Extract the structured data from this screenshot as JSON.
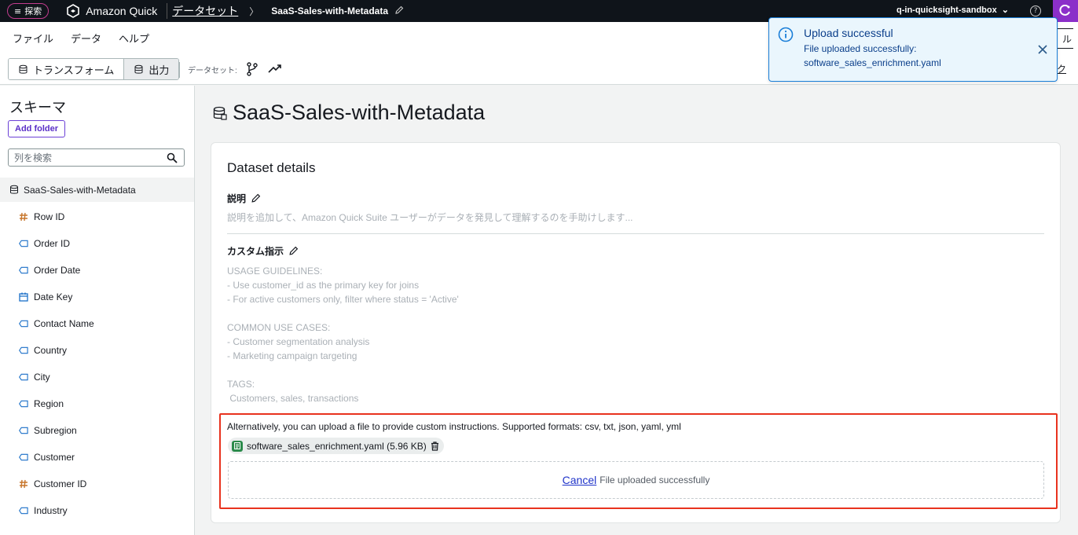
{
  "topbar": {
    "explore_label": "探索",
    "brand": "Amazon Quick",
    "breadcrumb_parent": "データセット",
    "breadcrumb_current": "SaaS-Sales-with-Metadata",
    "account": "q-in-quicksight-sandbox",
    "help": "?"
  },
  "menu": {
    "items": [
      "ファイル",
      "データ",
      "ヘルプ"
    ]
  },
  "toolbar": {
    "transform_label": "トランスフォーム",
    "output_label": "出力",
    "dataset_label": "データセット:",
    "right_button_fragment": "ル",
    "right_link_fragment": "ク"
  },
  "sidebar": {
    "title": "スキーマ",
    "add_folder": "Add folder",
    "search_placeholder": "列を検索",
    "dataset_name": "SaaS-Sales-with-Metadata",
    "fields": [
      {
        "name": "Row ID",
        "type": "number"
      },
      {
        "name": "Order ID",
        "type": "string"
      },
      {
        "name": "Order Date",
        "type": "string"
      },
      {
        "name": "Date Key",
        "type": "date"
      },
      {
        "name": "Contact Name",
        "type": "string"
      },
      {
        "name": "Country",
        "type": "string"
      },
      {
        "name": "City",
        "type": "string"
      },
      {
        "name": "Region",
        "type": "string"
      },
      {
        "name": "Subregion",
        "type": "string"
      },
      {
        "name": "Customer",
        "type": "string"
      },
      {
        "name": "Customer ID",
        "type": "number"
      },
      {
        "name": "Industry",
        "type": "string"
      }
    ]
  },
  "main": {
    "title": "SaaS-Sales-with-Metadata",
    "card_title": "Dataset details",
    "description_label": "説明",
    "description_placeholder": "説明を追加して、Amazon Quick Suite ユーザーがデータを発見して理解するのを手助けします...",
    "custom_label": "カスタム指示",
    "custom_instructions": "USAGE GUIDELINES:\n- Use customer_id as the primary key for joins\n- For active customers only, filter where status = 'Active'\n\nCOMMON USE CASES:\n- Customer segmentation analysis\n- Marketing campaign targeting\n\nTAGS:\n Customers, sales, transactions",
    "upload_description": "Alternatively, you can upload a file to provide custom instructions. Supported formats: csv, txt, json, yaml, yml",
    "file_chip": "software_sales_enrichment.yaml (5.96 KB)",
    "cancel_label": "Cancel",
    "drop_status": "File uploaded successfully"
  },
  "toast": {
    "title": "Upload successful",
    "line1": "File uploaded successfully:",
    "line2": "software_sales_enrichment.yaml"
  },
  "colors": {
    "highlight_border": "#e8321e",
    "toast_border": "#1a7ed8",
    "accent_purple": "#5a2fc7"
  }
}
